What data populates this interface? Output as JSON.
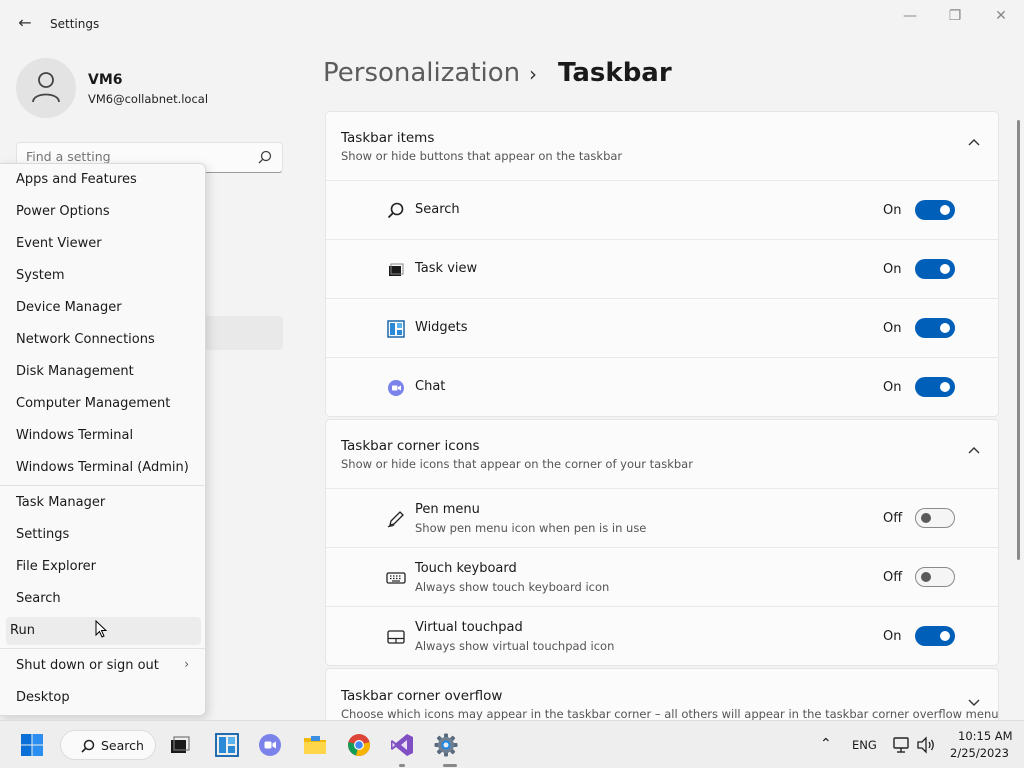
{
  "window": {
    "title": "Settings"
  },
  "user": {
    "name": "VM6",
    "email": "VM6@collabnet.local"
  },
  "search": {
    "placeholder": "Find a setting"
  },
  "breadcrumb": {
    "parent": "Personalization",
    "separator": "›",
    "current": "Taskbar"
  },
  "winx_menu": {
    "group1": [
      "Apps and Features",
      "Power Options",
      "Event Viewer",
      "System",
      "Device Manager",
      "Network Connections",
      "Disk Management",
      "Computer Management",
      "Windows Terminal",
      "Windows Terminal (Admin)"
    ],
    "group2": [
      "Task Manager",
      "Settings",
      "File Explorer",
      "Search",
      "Run"
    ],
    "group3": [
      "Shut down or sign out",
      "Desktop"
    ],
    "hovered": "Run"
  },
  "sections": [
    {
      "title": "Taskbar items",
      "subtitle": "Show or hide buttons that appear on the taskbar",
      "expanded": true,
      "rows": [
        {
          "label": "Search",
          "state": "On",
          "icon": "search-icon"
        },
        {
          "label": "Task view",
          "state": "On",
          "icon": "task-view-icon"
        },
        {
          "label": "Widgets",
          "state": "On",
          "icon": "widgets-icon"
        },
        {
          "label": "Chat",
          "state": "On",
          "icon": "chat-icon"
        }
      ]
    },
    {
      "title": "Taskbar corner icons",
      "subtitle": "Show or hide icons that appear on the corner of your taskbar",
      "expanded": true,
      "rows": [
        {
          "label": "Pen menu",
          "desc": "Show pen menu icon when pen is in use",
          "state": "Off",
          "icon": "pen-icon"
        },
        {
          "label": "Touch keyboard",
          "desc": "Always show touch keyboard icon",
          "state": "Off",
          "icon": "keyboard-icon"
        },
        {
          "label": "Virtual touchpad",
          "desc": "Always show virtual touchpad icon",
          "state": "On",
          "icon": "touchpad-icon"
        }
      ]
    },
    {
      "title": "Taskbar corner overflow",
      "subtitle": "Choose which icons may appear in the taskbar corner – all others will appear in the taskbar corner overflow menu",
      "expanded": false
    }
  ],
  "taskbar": {
    "search_label": "Search",
    "language": "ENG",
    "time": "10:15 AM",
    "date": "2/25/2023"
  },
  "colors": {
    "accent": "#005fb8",
    "background": "#f3f3f3",
    "card": "#fbfbfb"
  }
}
